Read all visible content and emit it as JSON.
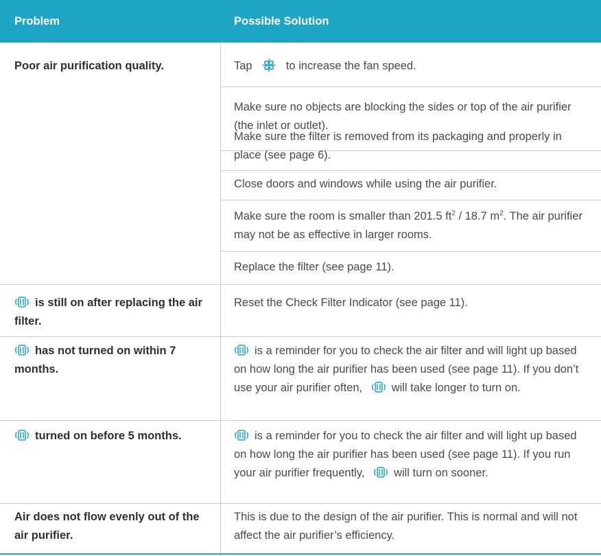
{
  "header": {
    "problem": "Problem",
    "solution": "Possible Solution"
  },
  "colors": {
    "accent": "#1ea4c5",
    "grid": "#cfcfcf",
    "icon": "#1ea4c5"
  },
  "icons": {
    "fan": "fan-icon",
    "filter": "check-filter-icon"
  },
  "rows": [
    {
      "problem": "Poor air purification quality.",
      "solutions": [
        {
          "a": "Tap",
          "b": "to increase the fan speed."
        },
        {
          "t": "Make sure no objects are blocking the sides or top of the air purifier (the inlet or outlet)."
        },
        {
          "t": "Make sure the filter is removed from its packaging and properly in place (see page 6)."
        },
        {
          "t": "Close doors and windows while using the air purifier."
        },
        {
          "a": "Make sure the room is smaller than 201.5 ft",
          "sup1": "2",
          "b": " / 18.7 m",
          "sup2": "2",
          "c": ". The air purifier may not be as effective in larger rooms."
        },
        {
          "t": "Replace the filter (see page 11)."
        }
      ]
    },
    {
      "problem": "is still on after replacing the air filter.",
      "solution": "Reset the Check Filter Indicator (see page 11)."
    },
    {
      "problem": "has not turned on within 7 months.",
      "solution_a": "is a reminder for you to check the air filter and will light up based on how long the air purifier has been used (see page 11). If you don’t use your air purifier often,",
      "solution_b": "will take longer to turn on."
    },
    {
      "problem": "turned on before 5 months.",
      "solution_a": "is a reminder for you to check the air filter and will light up based on how long the air purifier has been used (see page 11). If you run your air purifier frequently,",
      "solution_b": "will turn on sooner."
    },
    {
      "problem": "Air does not flow evenly out of the air purifier.",
      "solution": "This is due to the design of the air purifier. This is normal and will not affect the air purifier’s efficiency."
    }
  ]
}
